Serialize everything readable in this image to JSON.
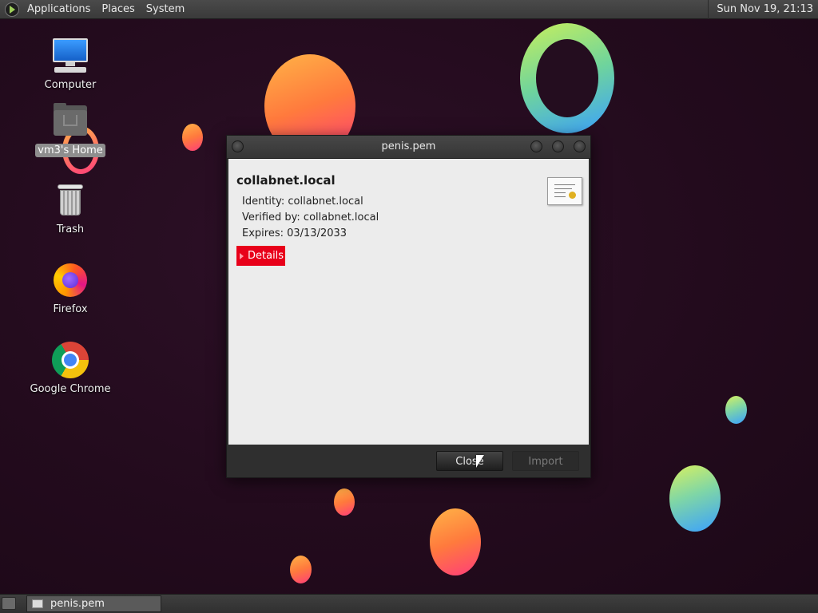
{
  "top_panel": {
    "menus": [
      "Applications",
      "Places",
      "System"
    ],
    "clock": "Sun Nov 19, 21:13"
  },
  "desktop": {
    "icons": [
      {
        "label": "Computer",
        "icon": "computer-icon"
      },
      {
        "label": "vm3's Home",
        "icon": "home-folder-icon",
        "selected": true
      },
      {
        "label": "Trash",
        "icon": "trash-icon"
      },
      {
        "label": "Firefox",
        "icon": "firefox-icon"
      },
      {
        "label": "Google Chrome",
        "icon": "chrome-icon"
      }
    ]
  },
  "dialog": {
    "title": "penis.pem",
    "certificate": {
      "name": "collabnet.local",
      "identity": "Identity: collabnet.local",
      "verified_by": "Verified by: collabnet.local",
      "expires": "Expires: 03/13/2033"
    },
    "details_label": "Details",
    "buttons": {
      "close": "Close",
      "import": "Import"
    },
    "colors": {
      "details_accent": "#e8001a"
    }
  },
  "taskbar": {
    "items": [
      {
        "label": "penis.pem",
        "icon": "window-icon"
      }
    ]
  }
}
